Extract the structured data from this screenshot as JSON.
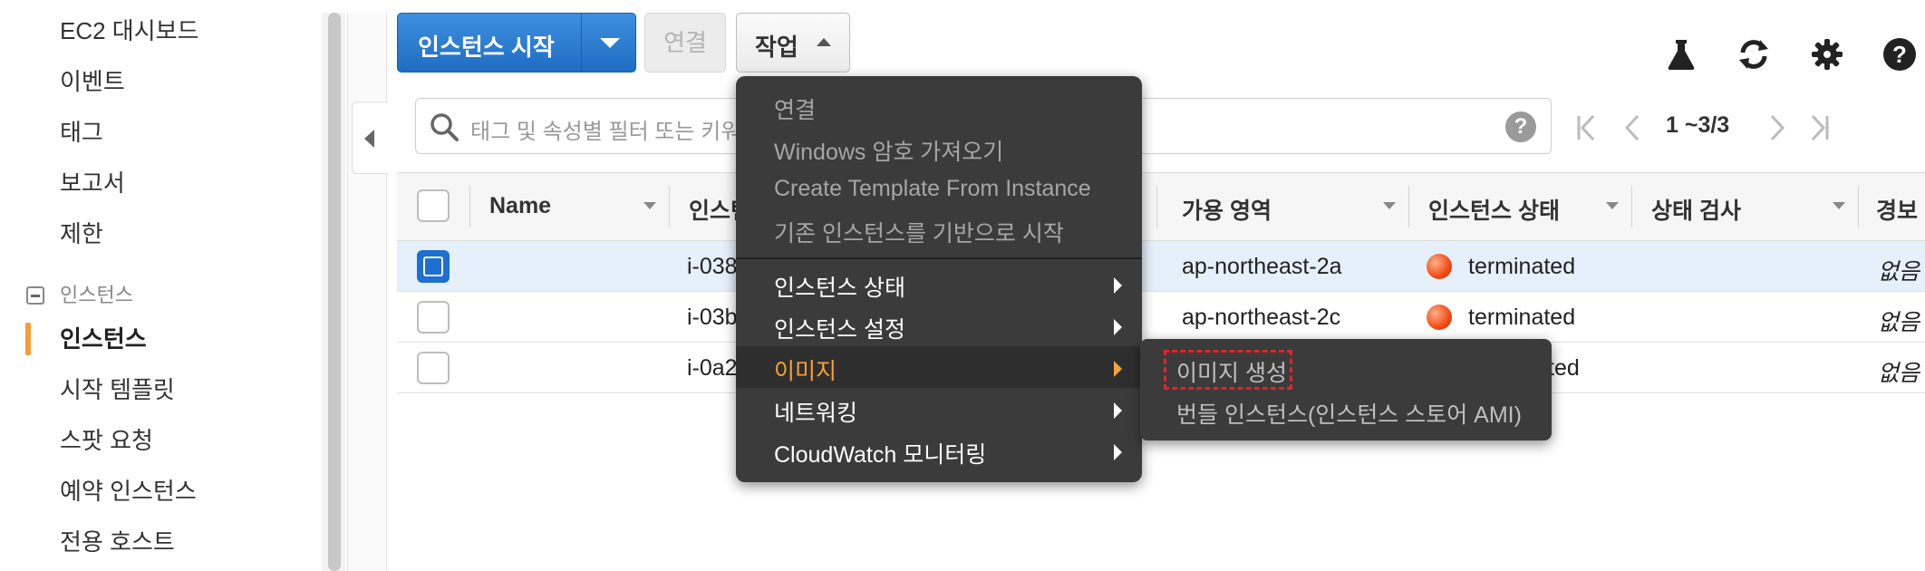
{
  "sidebar": {
    "items": [
      {
        "label": "EC2 대시보드"
      },
      {
        "label": "이벤트"
      },
      {
        "label": "태그"
      },
      {
        "label": "보고서"
      },
      {
        "label": "제한"
      }
    ],
    "group": {
      "label": "인스턴스",
      "items": [
        {
          "label": "인스턴스",
          "active": true
        },
        {
          "label": "시작 템플릿"
        },
        {
          "label": "스팟 요청"
        },
        {
          "label": "예약 인스턴스"
        },
        {
          "label": "전용 호스트"
        }
      ]
    },
    "active_color": "#f29d38"
  },
  "toolbar": {
    "launch_label": "인스턴스 시작",
    "connect_label": "연결",
    "actions_label": "작업",
    "icons": [
      "flask-icon",
      "refresh-icon",
      "gear-icon",
      "help-icon"
    ]
  },
  "search": {
    "placeholder": "태그 및 속성별 필터 또는 키워"
  },
  "pager": {
    "text": "1 ~3/3"
  },
  "table": {
    "columns": [
      {
        "label": "Name"
      },
      {
        "label": "인스턴"
      },
      {
        "label": "가용 영역"
      },
      {
        "label": "인스턴스 상태"
      },
      {
        "label": "상태 검사"
      },
      {
        "label": "경보"
      }
    ],
    "rows": [
      {
        "instance_id": "i-038",
        "zone": "ap-northeast-2a",
        "state": "terminated",
        "alarm": "없음",
        "selected": true
      },
      {
        "instance_id": "i-03b",
        "zone": "ap-northeast-2c",
        "state": "terminated",
        "alarm": "없음",
        "selected": false
      },
      {
        "instance_id": "i-0a2",
        "zone": "",
        "state": "ted",
        "alarm": "없음",
        "selected": false
      }
    ]
  },
  "actions_menu": {
    "disabled_items": [
      {
        "label": "연결"
      },
      {
        "label": "Windows 암호 가져오기"
      },
      {
        "label": "Create Template From Instance"
      },
      {
        "label": "기존 인스턴스를 기반으로 시작"
      }
    ],
    "submenus": [
      {
        "label": "인스턴스 상태"
      },
      {
        "label": "인스턴스 설정"
      },
      {
        "label": "이미지",
        "highlighted": true
      },
      {
        "label": "네트워킹"
      },
      {
        "label": "CloudWatch 모니터링"
      }
    ]
  },
  "image_submenu": {
    "items": [
      {
        "label": "이미지 생성"
      },
      {
        "label": "번들 인스턴스(인스턴스 스토어 AMI)"
      }
    ]
  },
  "colors": {
    "primary_button": "#1f6dc2",
    "menu_bg": "#3b3b3b",
    "menu_highlight": "#f4a33a",
    "annotation": "#e0262b",
    "status_terminated": "#f24b14"
  }
}
